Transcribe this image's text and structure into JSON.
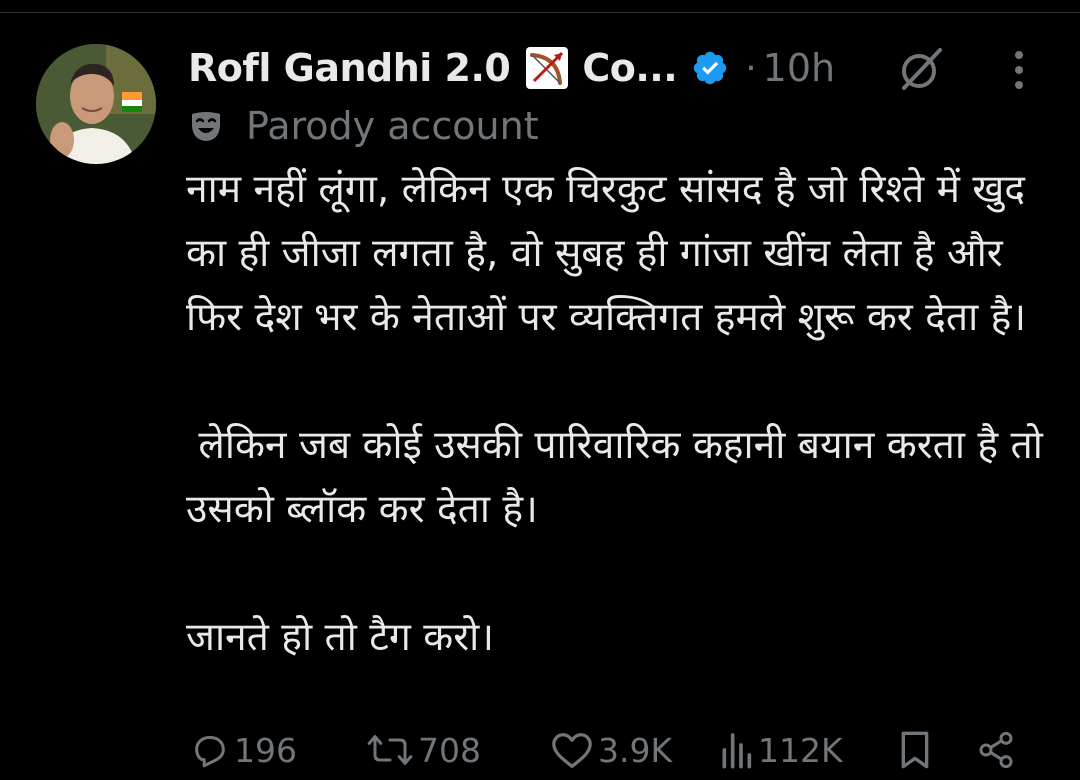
{
  "tweet": {
    "author_name": "Rofl Gandhi 2.0",
    "author_suffix": "Co...",
    "meta_separator": "·",
    "timestamp": "10h",
    "parody_label": "Parody account",
    "paragraphs": [
      "नाम नहीं लूंगा, लेकिन एक चिरकुट सांसद है जो रिश्ते में खुद का ही जीजा लगता है, वो सुबह ही गांजा खींच लेता है और फिर देश भर के नेताओं पर व्यक्तिगत हमले शुरू कर देता है।",
      " लेकिन जब कोई उसकी पारिवारिक कहानी बयान करता है तो उसको ब्लॉक कर देता है।",
      "जानते हो तो टैग करो।"
    ]
  },
  "actions": {
    "replies": "196",
    "reposts": "708",
    "likes": "3.9K",
    "views": "112K"
  },
  "icons": {
    "emoji": "bow-and-arrow-icon",
    "verified": "verified-badge-icon",
    "grok": "grok-icon",
    "more": "more-options-icon",
    "parody": "parody-mask-icon",
    "reply": "reply-icon",
    "repost": "repost-icon",
    "like": "heart-icon",
    "views": "views-icon",
    "bookmark": "bookmark-icon",
    "share": "share-icon"
  },
  "colors": {
    "background": "#000000",
    "text": "#e7e9ea",
    "muted": "#71767b",
    "verified": "#1d9bf0"
  }
}
